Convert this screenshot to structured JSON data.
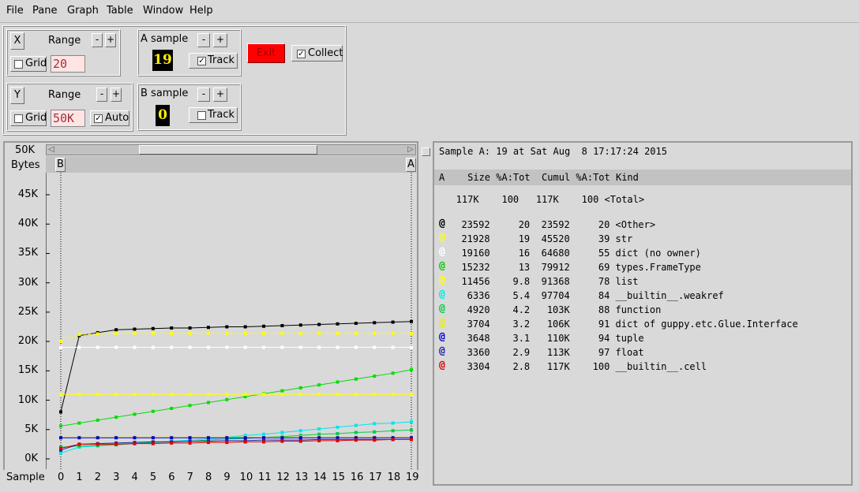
{
  "menu": [
    "File",
    "Pane",
    "Graph",
    "Table",
    "Window",
    "Help"
  ],
  "controls": {
    "x": {
      "axis_label": "X",
      "range_label": "Range",
      "minus": "-",
      "plus": "+",
      "grid_label": "Grid",
      "range_value": "20"
    },
    "y": {
      "axis_label": "Y",
      "range_label": "Range",
      "minus": "-",
      "plus": "+",
      "grid_label": "Grid",
      "range_value": "50K",
      "auto_label": "Auto",
      "auto_checked": true
    },
    "a_sample": {
      "label": "A sample",
      "minus": "-",
      "plus": "+",
      "value": "19",
      "track_label": "Track",
      "track_checked": true
    },
    "b_sample": {
      "label": "B sample",
      "minus": "-",
      "plus": "+",
      "value": "0",
      "track_label": "Track",
      "track_checked": false
    },
    "exit_label": "Exit",
    "collect_label": "Collect",
    "collect_checked": true
  },
  "graph": {
    "top_value": "50K",
    "unit_label": "Bytes",
    "marker_b": "B",
    "marker_a": "A",
    "sample_label": "Sample",
    "y_ticks": [
      "45K",
      "40K",
      "35K",
      "30K",
      "25K",
      "20K",
      "15K",
      "10K",
      "5K",
      "0K"
    ],
    "x_ticks": [
      "0",
      "1",
      "2",
      "3",
      "4",
      "5",
      "6",
      "7",
      "8",
      "9",
      "10",
      "11",
      "12",
      "13",
      "14",
      "15",
      "16",
      "17",
      "18",
      "19"
    ]
  },
  "chart_data": {
    "type": "line",
    "x": [
      0,
      1,
      2,
      3,
      4,
      5,
      6,
      7,
      8,
      9,
      10,
      11,
      12,
      13,
      14,
      15,
      16,
      17,
      18,
      19
    ],
    "ylim": [
      0,
      50000
    ],
    "ylabel": "Bytes",
    "xlabel": "Sample",
    "series": [
      {
        "color": "#000000",
        "values": [
          8000,
          21000,
          21500,
          22000,
          22100,
          22200,
          22300,
          22300,
          22400,
          22500,
          22500,
          22600,
          22700,
          22800,
          22900,
          23000,
          23100,
          23200,
          23300,
          23400
        ]
      },
      {
        "color": "#ffff00",
        "values": [
          20000,
          21200,
          21300,
          21400,
          21400,
          21400,
          21400,
          21400,
          21400,
          21400,
          21400,
          21400,
          21400,
          21400,
          21400,
          21400,
          21400,
          21400,
          21400,
          21400
        ]
      },
      {
        "color": "#ffffff",
        "values": [
          19000,
          19000,
          19000,
          19000,
          19000,
          19000,
          19000,
          19000,
          19000,
          19000,
          19000,
          19000,
          19000,
          19000,
          19000,
          19000,
          19000,
          19000,
          19000,
          19000
        ]
      },
      {
        "color": "#00dd00",
        "values": [
          5600,
          6100,
          6600,
          7100,
          7600,
          8100,
          8600,
          9100,
          9600,
          10100,
          10600,
          11100,
          11600,
          12100,
          12600,
          13100,
          13600,
          14100,
          14600,
          15200
        ]
      },
      {
        "color": "#ffff00",
        "values": [
          11000,
          11000,
          11000,
          11000,
          11000,
          11000,
          11000,
          11000,
          11000,
          11000,
          11000,
          11000,
          11000,
          11000,
          11000,
          11000,
          11000,
          11000,
          11000,
          11000
        ]
      },
      {
        "color": "#00e5ee",
        "values": [
          1000,
          2000,
          2200,
          2400,
          2600,
          2800,
          3000,
          3200,
          3400,
          3700,
          4000,
          4200,
          4500,
          4800,
          5100,
          5400,
          5700,
          6000,
          6100,
          6300
        ]
      },
      {
        "color": "#00cc44",
        "values": [
          2000,
          2200,
          2300,
          2400,
          2600,
          2800,
          2900,
          3000,
          3200,
          3400,
          3500,
          3700,
          3800,
          4000,
          4200,
          4300,
          4500,
          4600,
          4800,
          4900
        ]
      },
      {
        "color": "#eeee00",
        "values": [
          3700,
          3700,
          3700,
          3700,
          3700,
          3700,
          3700,
          3700,
          3700,
          3700,
          3700,
          3700,
          3700,
          3700,
          3700,
          3700,
          3700,
          3700,
          3700,
          3700
        ]
      },
      {
        "color": "#0000cc",
        "values": [
          3600,
          3600,
          3600,
          3600,
          3600,
          3600,
          3600,
          3600,
          3600,
          3600,
          3600,
          3600,
          3600,
          3600,
          3600,
          3600,
          3600,
          3600,
          3600,
          3600
        ]
      },
      {
        "color": "#2222aa",
        "values": [
          1500,
          2500,
          2600,
          2700,
          2800,
          2900,
          2900,
          3000,
          3000,
          3100,
          3100,
          3200,
          3200,
          3200,
          3300,
          3300,
          3300,
          3300,
          3300,
          3300
        ]
      },
      {
        "color": "#dd0000",
        "values": [
          1800,
          2500,
          2500,
          2500,
          2600,
          2600,
          2700,
          2700,
          2800,
          2800,
          2900,
          2900,
          3000,
          3000,
          3100,
          3100,
          3200,
          3200,
          3300,
          3300
        ]
      }
    ]
  },
  "table": {
    "header_line": "Sample A: 19 at Sat Aug  8 17:17:24 2015",
    "columns": "A    Size %A:Tot  Cumul %A:Tot Kind",
    "total_row": "   117K    100   117K    100 <Total>",
    "rows": [
      {
        "color": "#000000",
        "text": "  23592     20  23592     20 <Other>"
      },
      {
        "color": "#ffff00",
        "text": "  21928     19  45520     39 str"
      },
      {
        "color": "#ffffff",
        "text": "  19160     16  64680     55 dict (no owner)"
      },
      {
        "color": "#00cc00",
        "text": "  15232     13  79912     69 types.FrameType"
      },
      {
        "color": "#ffff00",
        "text": "  11456    9.8  91368     78 list"
      },
      {
        "color": "#00e5ee",
        "text": "   6336    5.4  97704     84 __builtin__.weakref"
      },
      {
        "color": "#00cc44",
        "text": "   4920    4.2   103K     88 function"
      },
      {
        "color": "#eeee00",
        "text": "   3704    3.2   106K     91 dict of guppy.etc.Glue.Interface"
      },
      {
        "color": "#0000cc",
        "text": "   3648    3.1   110K     94 tuple"
      },
      {
        "color": "#2222aa",
        "text": "   3360    2.9   113K     97 float"
      },
      {
        "color": "#dd0000",
        "text": "   3304    2.8   117K    100 __builtin__.cell"
      }
    ],
    "marker_glyph": "@"
  }
}
